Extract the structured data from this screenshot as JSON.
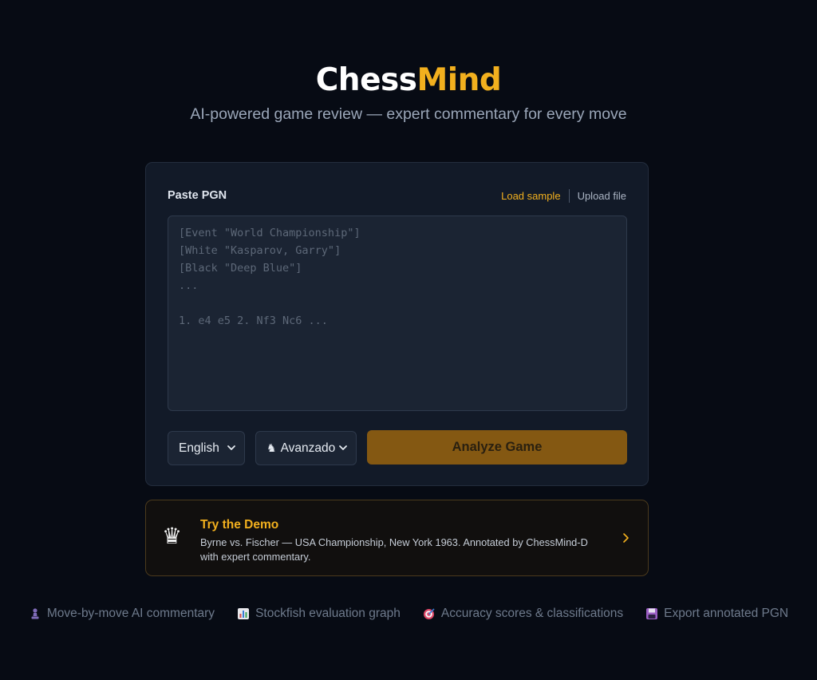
{
  "header": {
    "brand_part1": "Chess",
    "brand_part2": "Mind",
    "tagline": "AI-powered game review — expert commentary for every move"
  },
  "form": {
    "pgn_label": "Paste PGN",
    "load_sample": "Load sample",
    "upload_file": "Upload file",
    "pgn_placeholder": "[Event \"World Championship\"]\n[White \"Kasparov, Garry\"]\n[Black \"Deep Blue\"]\n...\n\n1. e4 e5 2. Nf3 Nc6 ...",
    "pgn_value": "",
    "language_selected": "English",
    "level_selected": "Avanzado",
    "analyze_label": "Analyze Game"
  },
  "demo": {
    "title": "Try the Demo",
    "description": "Byrne vs. Fischer — USA Championship, New York 1963. Annotated by ChessMind-D with expert commentary.",
    "icon": "queen-icon"
  },
  "features": [
    {
      "icon": "pawn-icon",
      "label": "Move-by-move AI commentary"
    },
    {
      "icon": "bar-chart-icon",
      "label": "Stockfish evaluation graph"
    },
    {
      "icon": "target-icon",
      "label": "Accuracy scores & classifications"
    },
    {
      "icon": "floppy-disk-icon",
      "label": "Export annotated PGN"
    }
  ],
  "colors": {
    "background": "#070b14",
    "accent": "#f2b01e",
    "card": "#121a28",
    "button": "#845812"
  }
}
